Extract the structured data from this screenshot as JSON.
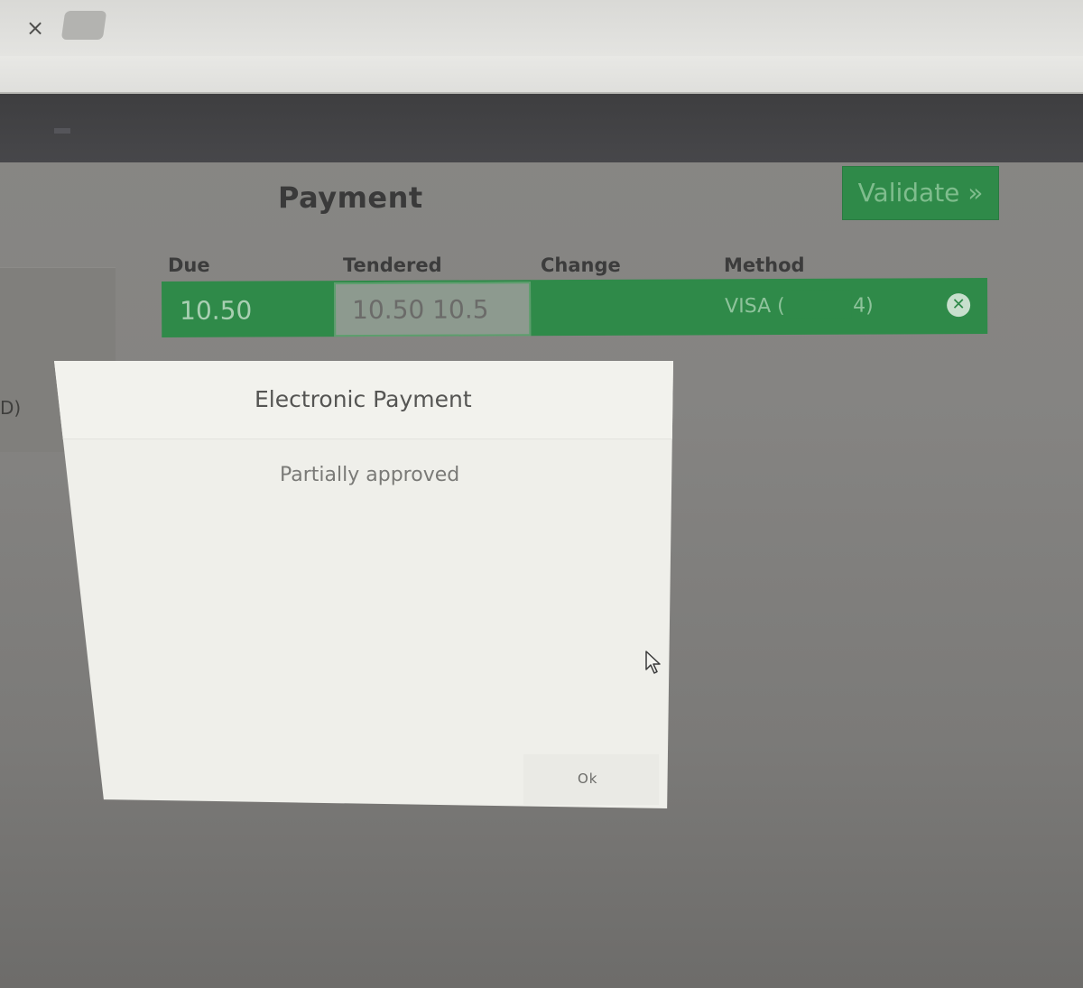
{
  "browser": {
    "close_tab_glyph": "×"
  },
  "left_panel": {
    "partial_text": "D)"
  },
  "payment": {
    "title": "Payment",
    "validate_label": "Validate »",
    "columns": {
      "due": "Due",
      "tendered": "Tendered",
      "change": "Change",
      "method": "Method"
    },
    "line": {
      "due": "10.50",
      "tendered": "10.50 10.5",
      "change": "",
      "method_prefix": "VISA (",
      "method_suffix": "4)",
      "remove_icon": "close-circle-icon"
    }
  },
  "modal": {
    "title": "Electronic Payment",
    "message": "Partially approved",
    "ok_label": "Ok"
  },
  "colors": {
    "accent_green": "#2f8a49",
    "topbar": "#3e3e40"
  }
}
